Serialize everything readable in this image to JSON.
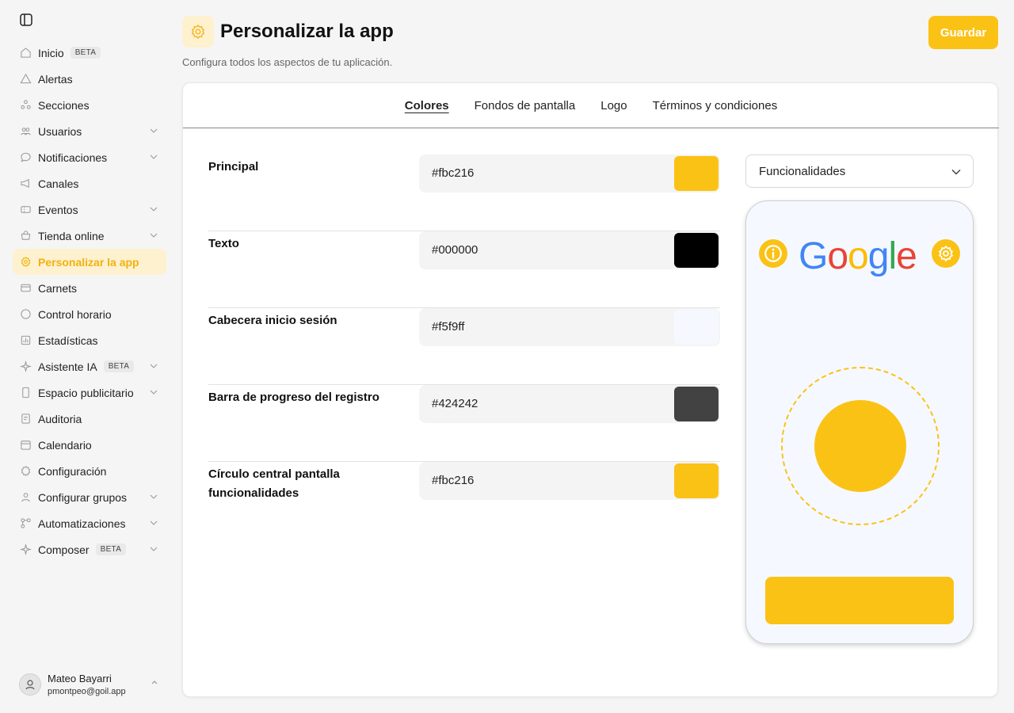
{
  "sidebar": {
    "items": [
      {
        "label": "Inicio",
        "badge": "BETA",
        "icon": "home-icon",
        "chevron": false,
        "active": false
      },
      {
        "label": "Alertas",
        "badge": "",
        "icon": "alert-icon",
        "chevron": false,
        "active": false
      },
      {
        "label": "Secciones",
        "badge": "",
        "icon": "sections-icon",
        "chevron": false,
        "active": false
      },
      {
        "label": "Usuarios",
        "badge": "",
        "icon": "users-icon",
        "chevron": true,
        "active": false
      },
      {
        "label": "Notificaciones",
        "badge": "",
        "icon": "chat-icon",
        "chevron": true,
        "active": false
      },
      {
        "label": "Canales",
        "badge": "",
        "icon": "megaphone-icon",
        "chevron": false,
        "active": false
      },
      {
        "label": "Eventos",
        "badge": "",
        "icon": "ticket-icon",
        "chevron": true,
        "active": false
      },
      {
        "label": "Tienda online",
        "badge": "",
        "icon": "store-icon",
        "chevron": true,
        "active": false
      },
      {
        "label": "Personalizar la app",
        "badge": "",
        "icon": "gear-icon",
        "chevron": false,
        "active": true
      },
      {
        "label": "Carnets",
        "badge": "",
        "icon": "card-icon",
        "chevron": false,
        "active": false
      },
      {
        "label": "Control horario",
        "badge": "",
        "icon": "clock-icon",
        "chevron": false,
        "active": false
      },
      {
        "label": "Estadísticas",
        "badge": "",
        "icon": "stats-icon",
        "chevron": false,
        "active": false
      },
      {
        "label": "Asistente IA",
        "badge": "BETA",
        "icon": "sparkle-icon",
        "chevron": true,
        "active": false
      },
      {
        "label": "Espacio publicitario",
        "badge": "",
        "icon": "phone-icon",
        "chevron": true,
        "active": false
      },
      {
        "label": "Auditoria",
        "badge": "",
        "icon": "audit-icon",
        "chevron": false,
        "active": false
      },
      {
        "label": "Calendario",
        "badge": "",
        "icon": "calendar-icon",
        "chevron": false,
        "active": false
      },
      {
        "label": "Configuración",
        "badge": "",
        "icon": "settings-icon",
        "chevron": false,
        "active": false
      },
      {
        "label": "Configurar grupos",
        "badge": "",
        "icon": "groups-icon",
        "chevron": true,
        "active": false
      },
      {
        "label": "Automatizaciones",
        "badge": "",
        "icon": "automation-icon",
        "chevron": true,
        "active": false
      },
      {
        "label": "Composer",
        "badge": "BETA",
        "icon": "sparkle-icon",
        "chevron": true,
        "active": false
      }
    ]
  },
  "user": {
    "name": "Mateo Bayarri",
    "email": "pmontpeo@goil.app"
  },
  "header": {
    "title": "Personalizar la app",
    "subtitle": "Configura todos los aspectos de tu aplicación.",
    "save_label": "Guardar"
  },
  "tabs": [
    {
      "label": "Colores",
      "active": true
    },
    {
      "label": "Fondos de pantalla",
      "active": false
    },
    {
      "label": "Logo",
      "active": false
    },
    {
      "label": "Términos y condiciones",
      "active": false
    }
  ],
  "colors": [
    {
      "label": "Principal",
      "value": "#fbc216"
    },
    {
      "label": "Texto",
      "value": "#000000"
    },
    {
      "label": "Cabecera inicio sesión",
      "value": "#f5f9ff"
    },
    {
      "label": "Barra de progreso del registro",
      "value": "#424242"
    },
    {
      "label": "Círculo central pantalla funcionalidades",
      "value": "#fbc216"
    }
  ],
  "preview": {
    "select_value": "Funcionalidades",
    "logo_letters": [
      "G",
      "o",
      "o",
      "g",
      "l",
      "e"
    ]
  },
  "theme": {
    "accent": "#fbc216",
    "active_bg": "#fdf1cf"
  }
}
